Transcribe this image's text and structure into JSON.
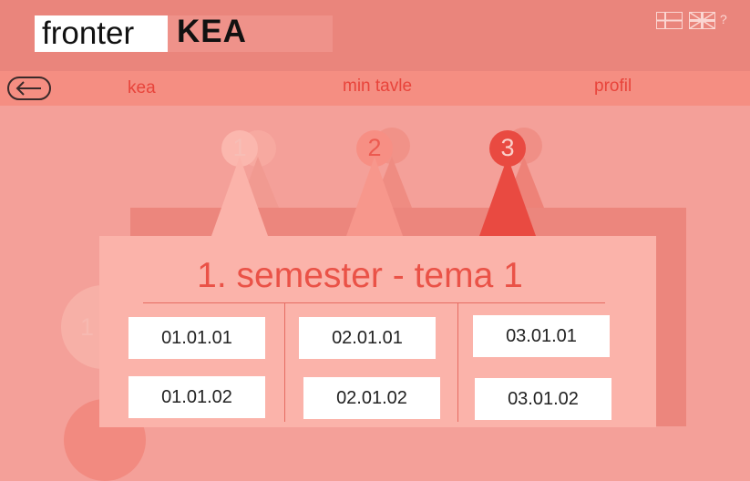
{
  "header": {
    "brand_fronter": "fronter",
    "brand_kea": "KEA",
    "help_label": "?"
  },
  "nav": {
    "items": [
      {
        "label": "kea"
      },
      {
        "label": "min tavle"
      },
      {
        "label": "profil"
      }
    ]
  },
  "semester_steps": [
    {
      "number": "1"
    },
    {
      "number": "2"
    },
    {
      "number": "3"
    }
  ],
  "side_step": "1",
  "panel": {
    "title": "1. semester - tema 1",
    "columns": [
      [
        "01.01.01",
        "01.01.02"
      ],
      [
        "02.01.01",
        "02.01.02"
      ],
      [
        "03.01.01",
        "03.01.02"
      ]
    ]
  },
  "colors": {
    "header": "#ea857c",
    "nav": "#f58e82",
    "background": "#f4a099",
    "panel": "#fbb3aa",
    "accent": "#e8443b"
  },
  "icons": [
    "danish-flag-icon",
    "uk-flag-icon",
    "back-arrow-icon"
  ]
}
